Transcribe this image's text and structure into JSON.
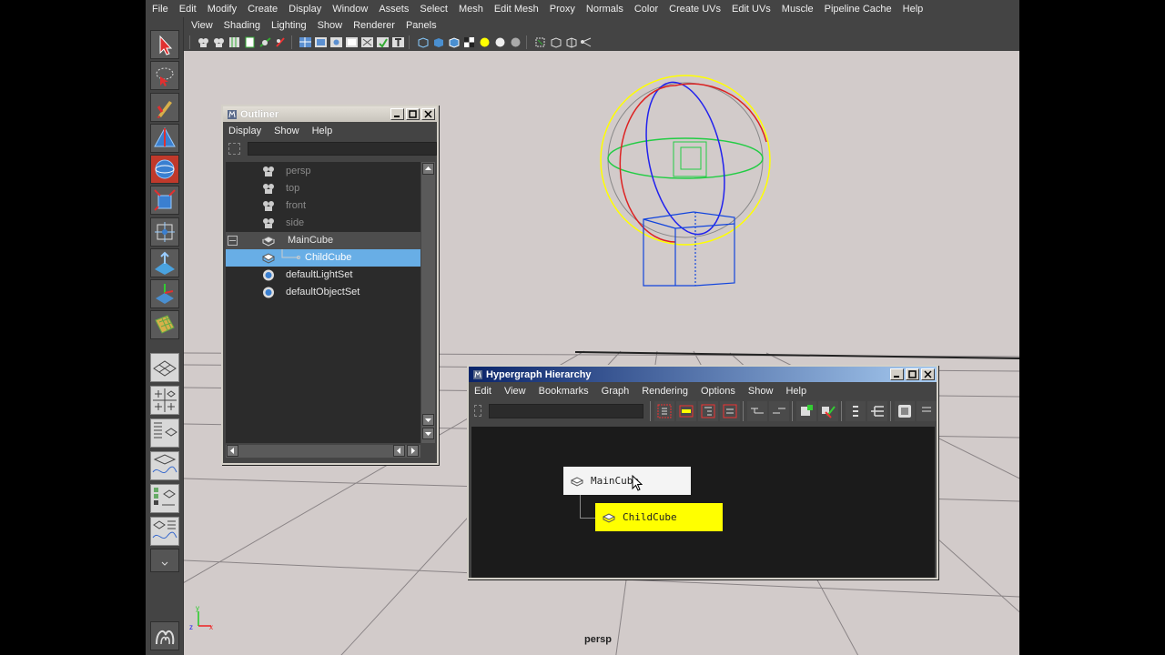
{
  "menubar": [
    "File",
    "Edit",
    "Modify",
    "Create",
    "Display",
    "Window",
    "Assets",
    "Select",
    "Mesh",
    "Edit Mesh",
    "Proxy",
    "Normals",
    "Color",
    "Create UVs",
    "Edit UVs",
    "Muscle",
    "Pipeline Cache",
    "Help"
  ],
  "panel_menu": [
    "View",
    "Shading",
    "Lighting",
    "Show",
    "Renderer",
    "Panels"
  ],
  "viewport": {
    "camera_label": "persp"
  },
  "outliner": {
    "title": "Outliner",
    "menu": [
      "Display",
      "Show",
      "Help"
    ],
    "items": [
      {
        "label": "persp",
        "icon": "camera-icon"
      },
      {
        "label": "top",
        "icon": "camera-icon"
      },
      {
        "label": "front",
        "icon": "camera-icon"
      },
      {
        "label": "side",
        "icon": "camera-icon"
      },
      {
        "label": "MainCube",
        "icon": "mesh-icon"
      },
      {
        "label": "ChildCube",
        "icon": "mesh-icon"
      },
      {
        "label": "defaultLightSet",
        "icon": "set-icon"
      },
      {
        "label": "defaultObjectSet",
        "icon": "set-icon"
      }
    ]
  },
  "hypergraph": {
    "title": "Hypergraph Hierarchy",
    "menu": [
      "Edit",
      "View",
      "Bookmarks",
      "Graph",
      "Rendering",
      "Options",
      "Show",
      "Help"
    ],
    "nodes": [
      {
        "label": "MainCube",
        "color": "#f4f4f4"
      },
      {
        "label": "ChildCube",
        "color": "#ffff00"
      }
    ]
  },
  "colors": {
    "viewport_bg": "#d2cbca",
    "selection": "#68aee6",
    "highlight_node": "#ffff00",
    "ui_bg": "#444444"
  }
}
